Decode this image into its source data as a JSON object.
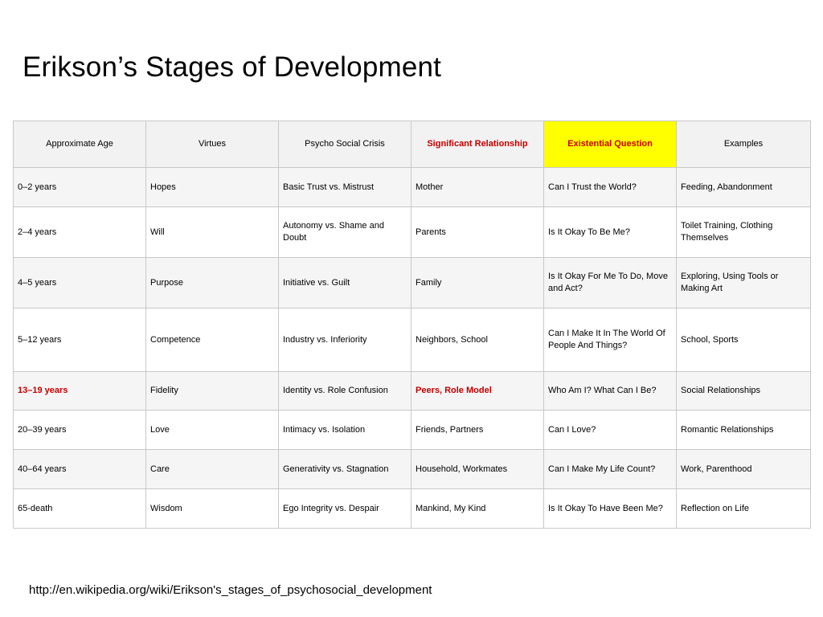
{
  "title": "Erikson’s Stages of Development",
  "columns": [
    "Approximate Age",
    "Virtues",
    "Psycho Social Crisis",
    "Significant Relationship",
    "Existential Question",
    "Examples"
  ],
  "highlight_colors": {
    "red_text": "#c00000",
    "yellow_header": "#ffff00"
  },
  "rows": [
    {
      "age": "0–2 years",
      "virtue": "Hopes",
      "crisis": "Basic Trust vs. Mistrust",
      "relationship": "Mother",
      "question": "Can I Trust the World?",
      "examples": "Feeding, Abandonment"
    },
    {
      "age": "2–4 years",
      "virtue": "Will",
      "crisis": "Autonomy vs. Shame and Doubt",
      "relationship": "Parents",
      "question": "Is It Okay To Be Me?",
      "examples": "Toilet Training, Clothing Themselves"
    },
    {
      "age": "4–5 years",
      "virtue": "Purpose",
      "crisis": "Initiative vs. Guilt",
      "relationship": "Family",
      "question": "Is It Okay For Me To Do, Move and Act?",
      "examples": "Exploring, Using Tools or Making Art"
    },
    {
      "age": "5–12 years",
      "virtue": "Competence",
      "crisis": "Industry vs. Inferiority",
      "relationship": "Neighbors, School",
      "question": "Can I Make It In The World Of People And Things?",
      "examples": "School, Sports"
    },
    {
      "age": "13–19 years",
      "virtue": "Fidelity",
      "crisis": "Identity vs. Role Confusion",
      "relationship": "Peers, Role Model",
      "question": "Who Am I? What Can I Be?",
      "examples": "Social Relationships"
    },
    {
      "age": "20–39 years",
      "virtue": "Love",
      "crisis": "Intimacy vs. Isolation",
      "relationship": "Friends, Partners",
      "question": "Can I Love?",
      "examples": "Romantic Relationships"
    },
    {
      "age": "40–64 years",
      "virtue": "Care",
      "crisis": "Generativity vs. Stagnation",
      "relationship": "Household, Workmates",
      "question": "Can I Make My Life Count?",
      "examples": "Work, Parenthood"
    },
    {
      "age": "65-death",
      "virtue": "Wisdom",
      "crisis": "Ego Integrity vs. Despair",
      "relationship": "Mankind, My Kind",
      "question": "Is It Okay To Have Been Me?",
      "examples": "Reflection on Life"
    }
  ],
  "source_url": "http://en.wikipedia.org/wiki/Erikson's_stages_of_psychosocial_development"
}
